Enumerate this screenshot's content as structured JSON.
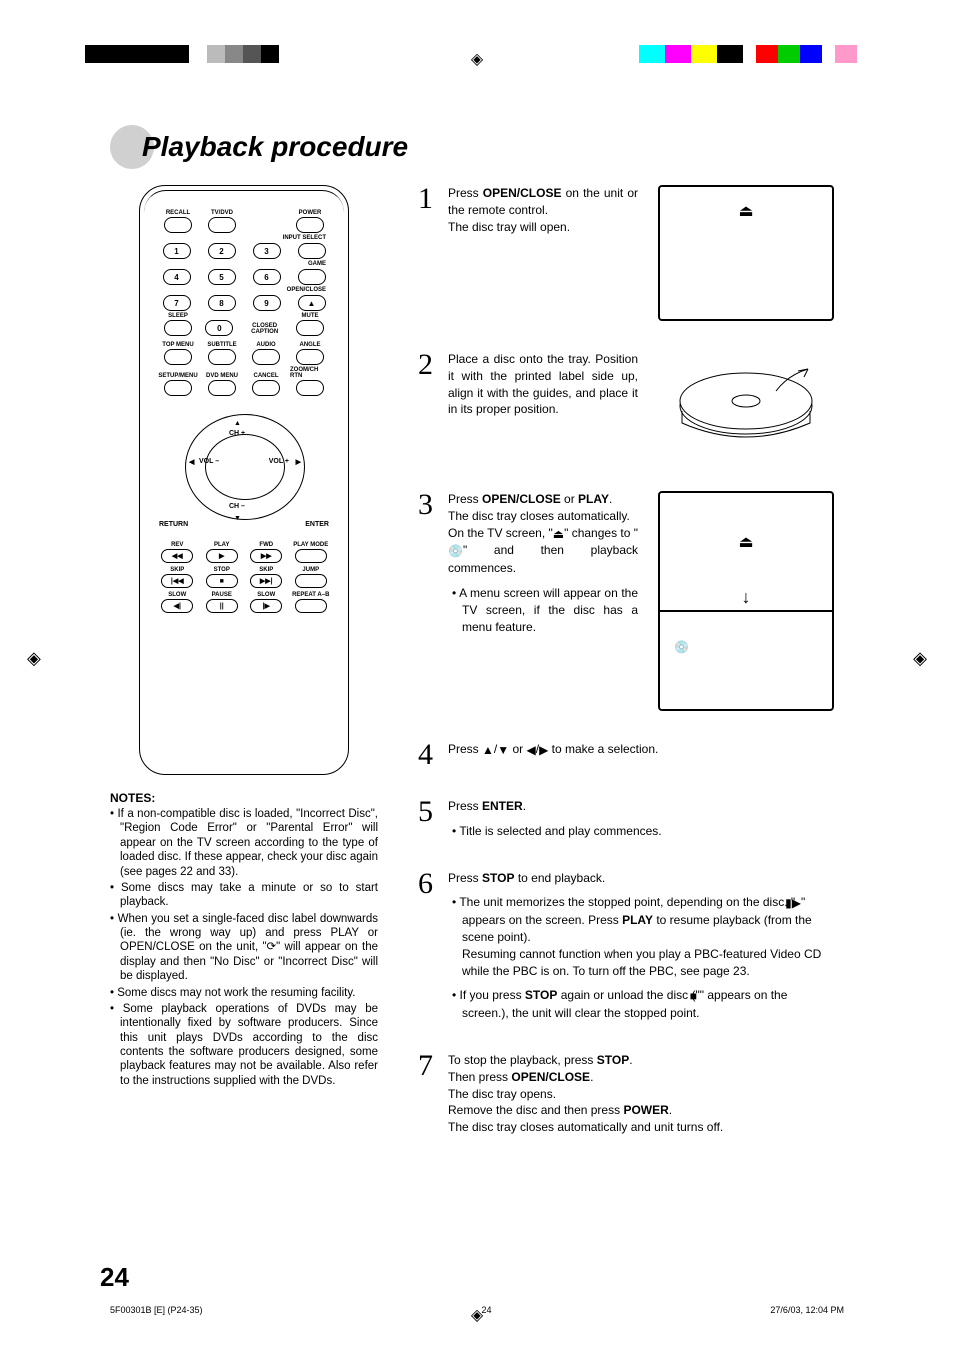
{
  "meta": {
    "page_number": "24",
    "footer_left": "5F00301B [E] (P24-35)",
    "footer_center": "24",
    "footer_right": "27/6/03, 12:04 PM"
  },
  "heading": "Playback procedure",
  "remote": {
    "row1": [
      "RECALL",
      "TV/DVD",
      "POWER"
    ],
    "right_labels": [
      "INPUT SELECT",
      "GAME",
      "OPEN/CLOSE"
    ],
    "nums": [
      "1",
      "2",
      "3",
      "4",
      "5",
      "6",
      "7",
      "8",
      "9",
      "0"
    ],
    "row_sleep": [
      "SLEEP",
      "CLOSED CAPTION",
      "MUTE"
    ],
    "row_menu1": [
      "TOP MENU",
      "SUBTITLE",
      "AUDIO",
      "ANGLE"
    ],
    "row_menu2": [
      "SETUP/MENU",
      "DVD MENU",
      "CANCEL",
      "ZOOM/CH RTN"
    ],
    "dpad": {
      "up": "CH +",
      "down": "CH –",
      "left": "VOL –",
      "right": "VOL +",
      "bl": "RETURN",
      "br": "ENTER"
    },
    "play_rows": [
      [
        "REV",
        "PLAY",
        "FWD",
        "PLAY MODE"
      ],
      [
        "SKIP",
        "STOP",
        "SKIP",
        "JUMP"
      ],
      [
        "SLOW",
        "PAUSE",
        "SLOW",
        "REPEAT A–B"
      ]
    ],
    "play_icons": [
      [
        "◀◀",
        "▶",
        "▶▶",
        ""
      ],
      [
        "|◀◀",
        "■",
        "▶▶|",
        ""
      ],
      [
        "◀|",
        "||",
        "|▶",
        ""
      ]
    ]
  },
  "notes": {
    "title": "NOTES:",
    "items": [
      "If a non-compatible disc is loaded, \"Incorrect Disc\", \"Region Code Error\" or \"Parental Error\" will appear on the TV screen according to the type of loaded disc. If these appear, check your disc again (see pages 22 and 33).",
      "Some discs may take a minute or so to start playback.",
      "When you set a single-faced disc label downwards (ie. the wrong way up) and press PLAY or OPEN/CLOSE on the unit, \"⟳\" will appear on the display and then \"No Disc\" or \"Incorrect Disc\" will be displayed.",
      "Some discs may not work the resuming facility.",
      "Some playback operations of DVDs may be intentionally fixed by software producers. Since this unit plays DVDs according to the disc contents the software producers designed, some playback features may not be available. Also refer to the instructions supplied with the DVDs."
    ]
  },
  "steps": {
    "s1": {
      "n": "1",
      "a": "Press ",
      "b": "OPEN/CLOSE",
      "c": " on the unit or the remote control.",
      "d": "The disc tray will open."
    },
    "s2": {
      "n": "2",
      "text": "Place a disc onto the tray. Position it with the printed label side up, align it with the guides, and place it in its proper position."
    },
    "s3": {
      "n": "3",
      "a": "Press ",
      "b": "OPEN/CLOSE",
      "c": " or ",
      "d": "PLAY",
      "e": ".",
      "line2": "The disc tray closes automatically.",
      "line3a": "On the TV screen, \"",
      "line3b": "\" changes to \"",
      "line3c": "\" and then playback commences.",
      "bullet": "A menu screen will appear on the TV screen, if the disc has a menu feature."
    },
    "s4": {
      "n": "4",
      "a": "Press ",
      "b": " to make a selection."
    },
    "s5": {
      "n": "5",
      "a": "Press ",
      "b": "ENTER",
      "c": ".",
      "bullet": "Title is selected and play commences."
    },
    "s6": {
      "n": "6",
      "a": "Press ",
      "b": "STOP",
      "c": " to end playback.",
      "b1a": "The unit memorizes the stopped point, depending on the disc. \"",
      "b1b": "\" appears on the screen. Press ",
      "b1c": "PLAY",
      "b1d": " to resume playback (from the scene point).",
      "b1e": "Resuming cannot function when you play a PBC-featured Video CD while the PBC is on. To turn off the PBC, see page 23.",
      "b2a": "If you press ",
      "b2b": "STOP",
      "b2c": " again or unload the disc (\"",
      "b2d": "\" appears on the screen.), the unit will clear the stopped point."
    },
    "s7": {
      "n": "7",
      "l1a": "To stop the playback, press ",
      "l1b": "STOP",
      "l1c": ".",
      "l2a": "Then press ",
      "l2b": "OPEN/CLOSE",
      "l2c": ".",
      "l3": "The disc tray opens.",
      "l4a": "Remove the disc and then press ",
      "l4b": "POWER",
      "l4c": ".",
      "l5": "The disc tray closes automatically and unit turns off."
    }
  }
}
